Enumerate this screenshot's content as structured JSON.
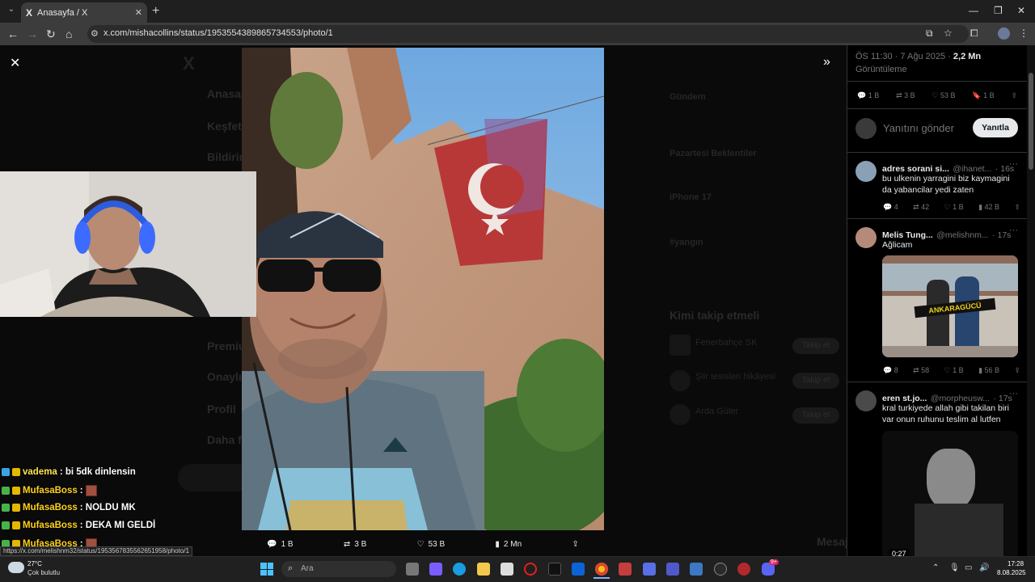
{
  "browser": {
    "tab_title": "Anasayfa / X",
    "tab_x_glyph": "X",
    "url": "x.com/mishacollins/status/1953554389865734553/photo/1"
  },
  "background_page": {
    "menu": [
      "Anasayfa",
      "Keşfet",
      "Bildirimler",
      "Premium",
      "Onaylı",
      "Profil",
      "Daha fazla"
    ],
    "trends": [
      "Gündem",
      "Pazartesi Beklentiler",
      "iPhone 17",
      "#yangın"
    ],
    "who_to_follow_title": "Kimi takip etmeli",
    "follow_suggestions": [
      "Fenerbahçe SK",
      "Şiir tesisleri hikâyesi",
      "Arda Güler"
    ],
    "follow_label": "Takip et",
    "messages_label": "Mesajlar"
  },
  "tweet_meta": {
    "time": "ÖS 11:30 · 7 Ağu 2025 ·",
    "views_value": "2,2 Mn",
    "views_label": "Görüntüleme",
    "replies": "1 B",
    "retweets": "3 B",
    "likes": "53 B",
    "bookmarks": "1 B"
  },
  "reply_box": {
    "placeholder": "Yanıtını gönder",
    "button": "Yanıtla"
  },
  "replies": [
    {
      "name": "adres sorani si...",
      "handle": "@ihanet...",
      "time": "· 16s",
      "text": "bu ulkenin yarragini biz kaymagini da yabancilar yedi zaten",
      "stats": [
        "4",
        "42",
        "1 B",
        "42 B"
      ]
    },
    {
      "name": "Melis Tung...",
      "handle": "@melishnm...",
      "time": "· 17s",
      "text": "Ağlicam",
      "image_text": "ANKARAGÜCÜ",
      "stats": [
        "8",
        "58",
        "1 B",
        "56 B"
      ]
    },
    {
      "name": "eren st.jo...",
      "handle": "@morpheusw...",
      "time": "· 17s",
      "text": "kral turkiyede allah gibi takilan biri var onun ruhunu teslim al lutfen",
      "video_duration": "0:27"
    }
  ],
  "photo_actions": {
    "replies": "1 B",
    "retweets": "3 B",
    "likes": "53 B",
    "views": "2 Mn"
  },
  "chat": [
    {
      "user": "vadema",
      "message": ": bi 5dk dinlensin"
    },
    {
      "user": "MufasaBoss",
      "message": " :"
    },
    {
      "user": "MufasaBoss",
      "message": " : NOLDU MK"
    },
    {
      "user": "MufasaBoss",
      "message": " : DEKA MI GELDİ"
    },
    {
      "user": "MufasaBoss",
      "message": " :"
    }
  ],
  "status_link": "https://x.com/melishnm32/status/1953567835562651958/photo/1",
  "taskbar": {
    "weather_temp": "27°C",
    "weather_desc": "Çok bulutlu",
    "search_placeholder": "Ara",
    "time": "17:28",
    "date": "8.08.2025",
    "discord_badge": "9+"
  },
  "colors": {
    "x_blue": "#1d9bf0",
    "reply_button_bg": "#e7e9ea",
    "turkish_red": "#c0392b"
  }
}
